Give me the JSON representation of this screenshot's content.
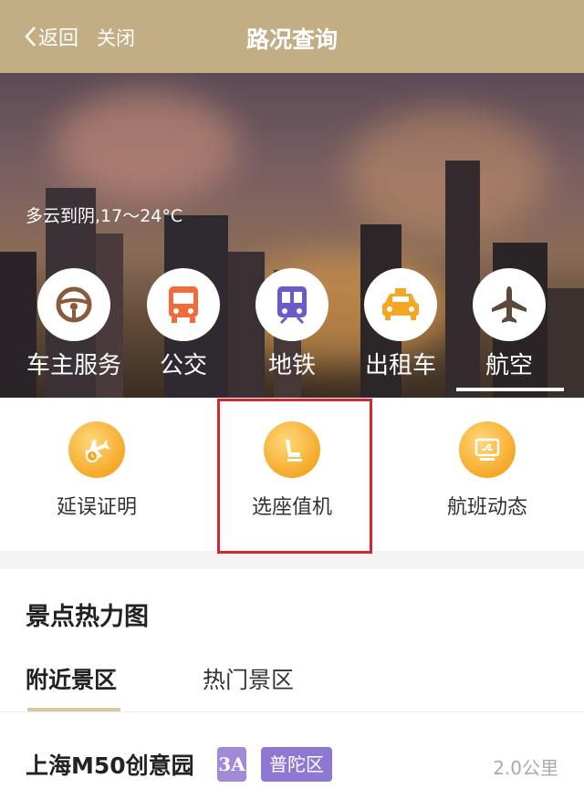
{
  "header": {
    "back_label": "返回",
    "close_label": "关闭",
    "title": "路况查询"
  },
  "banner": {
    "weather": "多云到阴,17～24°C",
    "transport": [
      {
        "label": "车主服务",
        "icon": "steering-wheel-icon",
        "color": "#8a5a3c"
      },
      {
        "label": "公交",
        "icon": "bus-icon",
        "color": "#f26c3b"
      },
      {
        "label": "地铁",
        "icon": "metro-icon",
        "color": "#6a5bc9"
      },
      {
        "label": "出租车",
        "icon": "taxi-icon",
        "color": "#f5a623"
      },
      {
        "label": "航空",
        "icon": "airplane-icon",
        "color": "#5b4a3c"
      }
    ],
    "selected": "航空"
  },
  "services": [
    {
      "label": "延误证明",
      "icon": "flight-delay-icon"
    },
    {
      "label": "选座值机",
      "icon": "seat-icon"
    },
    {
      "label": "航班动态",
      "icon": "flight-status-icon"
    }
  ],
  "heatmap": {
    "title": "景点热力图",
    "tabs": [
      "附近景区",
      "热门景区"
    ],
    "active_tab": "附近景区",
    "places": [
      {
        "name": "上海M50创意园",
        "level": "3A",
        "district": "普陀区",
        "distance": "2.0公里"
      }
    ]
  },
  "colors": {
    "header": "#c2ad84",
    "accent": "#f5a623",
    "highlight_box": "#d9252d"
  }
}
